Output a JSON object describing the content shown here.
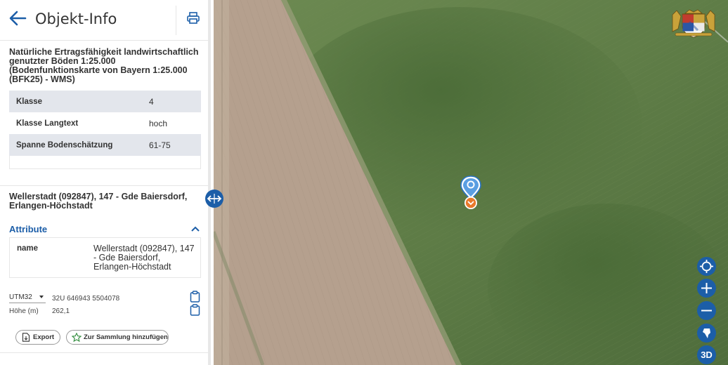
{
  "header": {
    "title": "Objekt-Info",
    "back_icon": "arrow-left-icon",
    "print_icon": "printer-icon"
  },
  "section1": {
    "title": "Natürliche Ertragsfähigkeit landwirtschaftlich genutzter Böden 1:25.000 (Bodenfunktionskarte von Bayern 1:25.000 (BFK25) - WMS)",
    "rows": [
      {
        "key": "Klasse",
        "value": "4"
      },
      {
        "key": "Klasse Langtext",
        "value": "hoch"
      },
      {
        "key": "Spanne Bodenschätzung",
        "value": "61-75"
      }
    ]
  },
  "section2": {
    "title": "Wellerstadt (092847), 147 - Gde Baiersdorf, Erlangen-Höchstadt",
    "attribute_heading": "Attribute",
    "attribute_key": "name",
    "attribute_value": "Wellerstadt (092847), 147 - Gde Baiersdorf, Erlangen-Höchstadt"
  },
  "position": {
    "crs_selected": "UTM32",
    "coordinates": "32U 646943 5504078",
    "height_label": "Höhe (m)",
    "height_value": "262,1"
  },
  "actions": {
    "export_label": "Export",
    "collection_label": "Zur Sammlung hinzufügen"
  },
  "map_controls": {
    "three_d_label": "3D"
  },
  "colors": {
    "accent": "#1c5ea8",
    "table_stripe": "#e3e6ec",
    "marker_orange": "#e8792a"
  }
}
